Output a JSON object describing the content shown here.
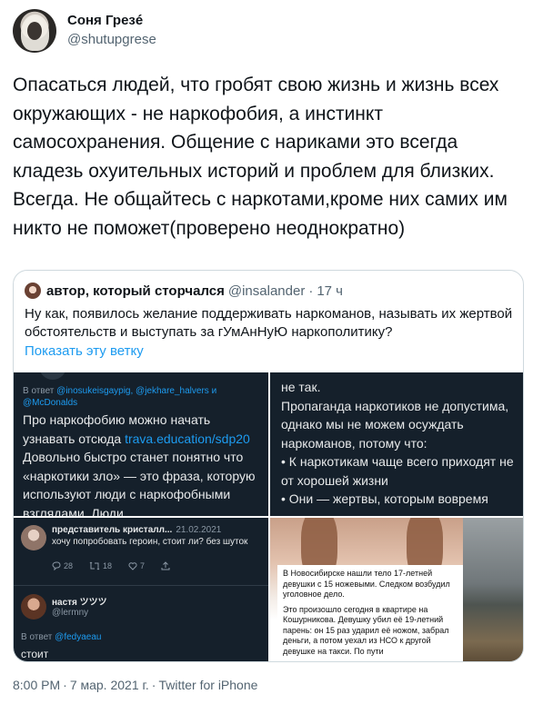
{
  "author": {
    "display_name": "Соня Грезé",
    "handle": "@shutupgrese"
  },
  "tweet": {
    "text": "Опасаться людей, что гробят свою жизнь и жизнь всех окружающих - не наркофобия, а инстинкт самосохранения. Общение с нариками это всегда кладезь охуительных историй и проблем для близких. Всегда. Не общайтесь с наркотами,кроме них самих им никто не поможет(проверено неоднократно)"
  },
  "quote": {
    "display_name": "автор, который сторчался",
    "handle": "@insalander",
    "separator": "·",
    "time": "17 ч",
    "text": "Ну как, появилось желание поддерживать наркоманов, называть их жертвой обстоятельств и выступать за гУмАнНуЮ наркополитику?",
    "show_thread": "Показать эту ветку",
    "images": {
      "top_left": {
        "reply_prefix": "В ответ",
        "reply_handles": "@inosukeisgaypig, @jekhare_halvers и @McDonalds",
        "text_before_link": "Про наркофобию можно начать узнавать отсюда ",
        "link": "trava.education/sdp20",
        "text_after_link": " Довольно быстро станет понятно что «наркотики зло» — это фраза, которую используют люди с наркофобными взглядами. Люди"
      },
      "top_right": {
        "text": "не так.\nПропаганда наркотиков не допустима, однако мы не можем осуждать наркоманов, потому что:\n• К наркотикам чаще всего приходят не от хорошей жизни\n• Они — жертвы, которым вовремя"
      },
      "bottom_left": {
        "post1": {
          "name": "представитель кристалл...",
          "date": "21.02.2021",
          "text": "хочу попробовать героин, стоит ли? без шуток",
          "replies": "28",
          "retweets": "18",
          "likes": "7"
        },
        "post2": {
          "name": "настя ツツツ",
          "handle": "@lermny",
          "reply_prefix": "В ответ",
          "reply_handle": "@fedyaeau",
          "text": "стоит"
        }
      },
      "bottom_right": {
        "p1": "В Новосибирске нашли тело 17-летней девушки с 15 ножевыми. Следком возбудил уголовное дело.",
        "p2": "Это произошло сегодня в квартире на Кошурникова. Девушку убил её 19-летний парень: он 15 раз ударил её ножом, забрал деньги, а потом уехал из НСО к другой девушке на такси. По пути"
      }
    }
  },
  "footer": {
    "time": "8:00 PM",
    "dot": "·",
    "date": "7 мар. 2021 г.",
    "source": "Twitter for iPhone"
  },
  "icons": {
    "more": "more-icon",
    "reply": "reply-icon",
    "retweet": "retweet-icon",
    "like": "heart-icon",
    "share": "share-icon"
  },
  "colors": {
    "link": "#1d9bf0",
    "secondary": "#536471",
    "dark_bg": "#15202b"
  }
}
